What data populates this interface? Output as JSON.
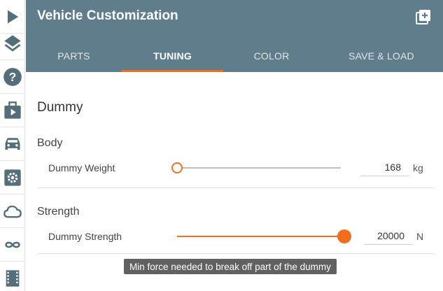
{
  "header": {
    "title": "Vehicle Customization",
    "action_icon": "add-box-icon"
  },
  "tabs": [
    {
      "label": "PARTS",
      "active": false
    },
    {
      "label": "TUNING",
      "active": true
    },
    {
      "label": "COLOR",
      "active": false
    },
    {
      "label": "SAVE & LOAD",
      "active": false
    }
  ],
  "sidebar": {
    "icons": [
      "play-icon",
      "layers-icon",
      "help-icon",
      "briefcase-play-icon",
      "car-icon",
      "settings-box-icon",
      "cloud-icon",
      "infinity-icon",
      "film-strip-icon"
    ]
  },
  "section": {
    "title": "Dummy",
    "groups": [
      {
        "title": "Body",
        "rows": [
          {
            "label": "Dummy Weight",
            "value": "168",
            "unit": "kg",
            "slider_fraction": 0.0
          }
        ]
      },
      {
        "title": "Strength",
        "rows": [
          {
            "label": "Dummy Strength",
            "value": "20000",
            "unit": "N",
            "slider_fraction": 1.0
          }
        ]
      }
    ]
  },
  "tooltip": "Min force needed to break off part of the dummy",
  "colors": {
    "header": "#607d8b",
    "accent": "#f26f1f",
    "icon": "#546e7a"
  }
}
